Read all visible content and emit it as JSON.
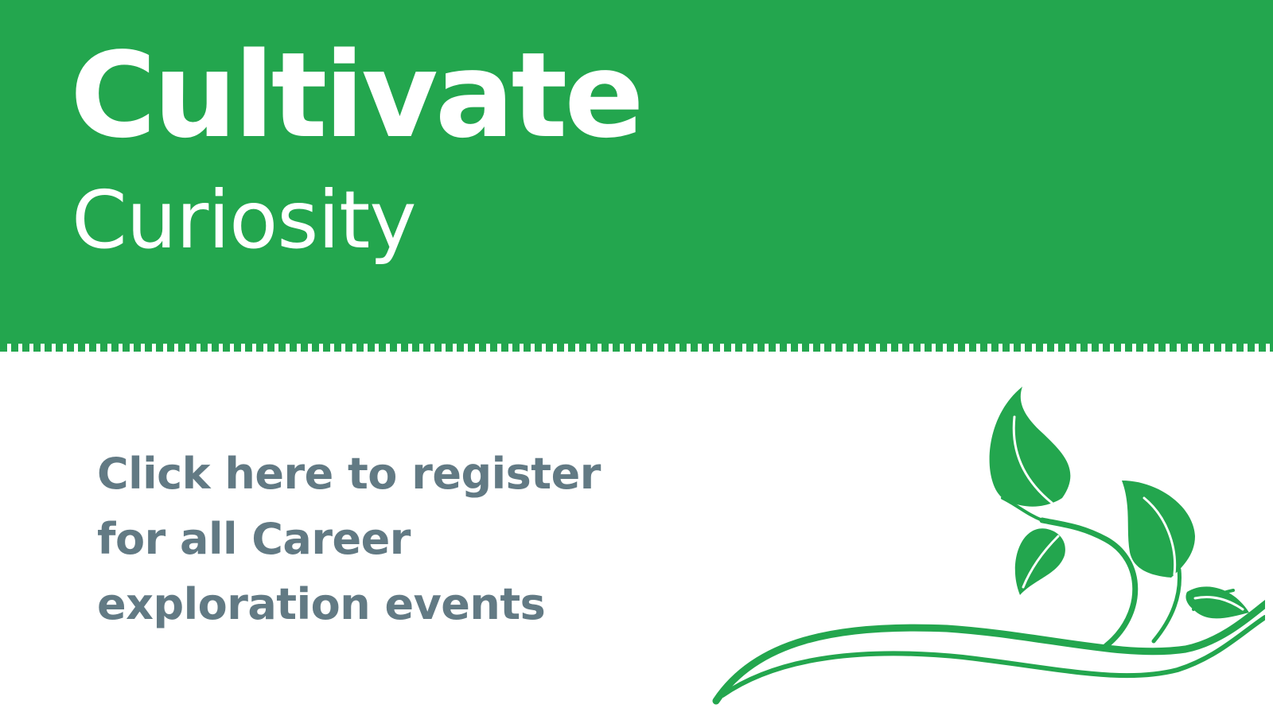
{
  "banner": {
    "title": "Cultivate",
    "subtitle": "Curiosity"
  },
  "cta": {
    "text": "Click here to register for all Career exploration events"
  },
  "decoration": {
    "icon": "sprout-vine-icon"
  },
  "colors": {
    "brand": "#23a64e",
    "text": "#627a84",
    "background": "#ffffff"
  }
}
